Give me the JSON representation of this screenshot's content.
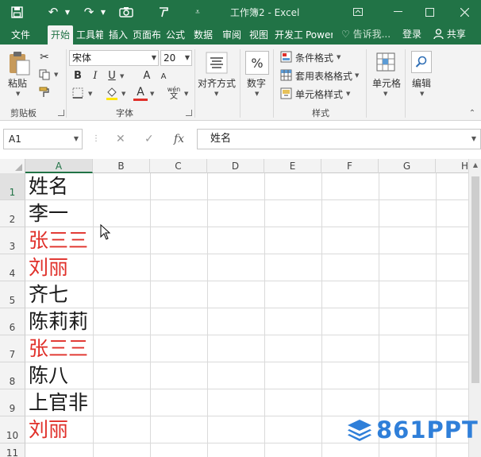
{
  "window": {
    "title": "工作簿2 - Excel"
  },
  "tabs": [
    {
      "label": "文件"
    },
    {
      "label": "开始"
    },
    {
      "label": "工具箱"
    },
    {
      "label": "插入"
    },
    {
      "label": "页面布局"
    },
    {
      "label": "公式"
    },
    {
      "label": "数据"
    },
    {
      "label": "审阅"
    },
    {
      "label": "视图"
    },
    {
      "label": "开发工具"
    },
    {
      "label": "Power"
    }
  ],
  "tell_me": "告诉我...",
  "login": "登录",
  "share": "共享",
  "ribbon": {
    "clipboard": {
      "paste": "粘贴",
      "group": "剪贴板"
    },
    "font": {
      "name": "宋体",
      "size": "20",
      "group": "字体",
      "bold": "B",
      "italic": "I",
      "underline": "U",
      "grow": "A",
      "shrink": "A",
      "font_color": "A",
      "phonetic_top": "wén",
      "phonetic_bottom": "文"
    },
    "alignment": {
      "label": "对齐方式"
    },
    "number": {
      "label": "数字",
      "symbol": "%"
    },
    "styles": {
      "conditional": "条件格式",
      "table": "套用表格格式",
      "cell": "单元格样式",
      "group": "样式"
    },
    "cells": {
      "label": "单元格"
    },
    "editing": {
      "label": "编辑"
    }
  },
  "formula_bar": {
    "name_box": "A1",
    "fx": "fx",
    "content": "姓名"
  },
  "sheet": {
    "columns": [
      "A",
      "B",
      "C",
      "D",
      "E",
      "F",
      "G",
      "H"
    ],
    "rows": [
      {
        "num": "1",
        "a": "姓名",
        "color": "#1a1a1a"
      },
      {
        "num": "2",
        "a": "李一",
        "color": "#1a1a1a"
      },
      {
        "num": "3",
        "a": "张三三",
        "color": "#e0302a"
      },
      {
        "num": "4",
        "a": "刘丽",
        "color": "#e0302a"
      },
      {
        "num": "5",
        "a": "齐七",
        "color": "#1a1a1a"
      },
      {
        "num": "6",
        "a": "陈莉莉",
        "color": "#1a1a1a"
      },
      {
        "num": "7",
        "a": "张三三",
        "color": "#e0302a"
      },
      {
        "num": "8",
        "a": "陈八",
        "color": "#1a1a1a"
      },
      {
        "num": "9",
        "a": "上官非",
        "color": "#1a1a1a"
      },
      {
        "num": "10",
        "a": "刘丽",
        "color": "#e0302a"
      },
      {
        "num": "11",
        "a": "",
        "color": "#1a1a1a"
      }
    ]
  },
  "watermark": "861PPT",
  "colors": {
    "excel_green": "#217346",
    "duplicate_red": "#e0302a",
    "watermark_blue": "#2f7fd9"
  }
}
